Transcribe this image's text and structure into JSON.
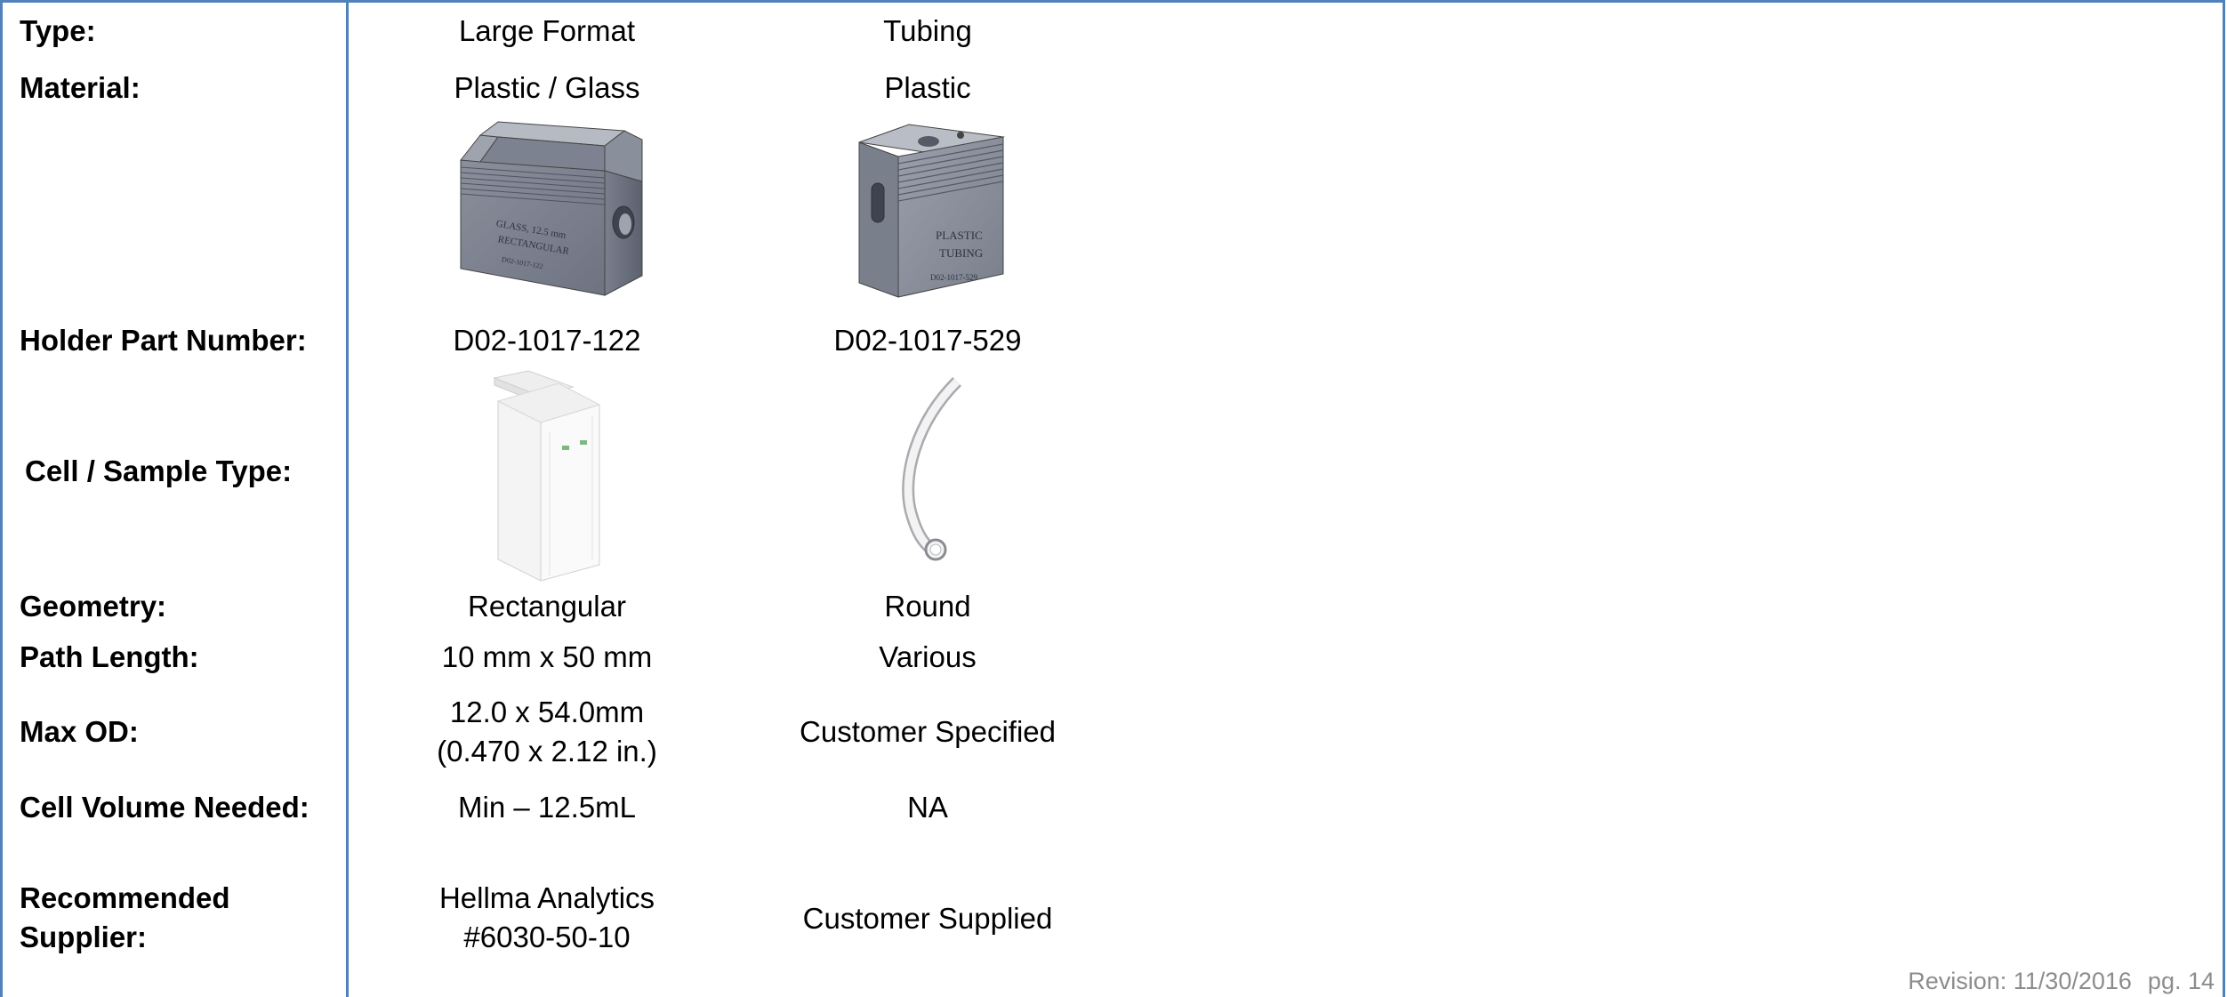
{
  "rows": {
    "type": {
      "label": "Type:",
      "col1": "Large Format",
      "col2": "Tubing"
    },
    "material": {
      "label": "Material:",
      "col1": "Plastic / Glass",
      "col2": "Plastic"
    },
    "holder_part": {
      "label": "Holder Part Number:",
      "col1": "D02-1017-122",
      "col2": "D02-1017-529"
    },
    "cell_sample": {
      "label": "Cell / Sample Type:"
    },
    "geometry": {
      "label": "Geometry:",
      "col1": "Rectangular",
      "col2": "Round"
    },
    "path_length": {
      "label": "Path Length:",
      "col1": "10 mm x 50 mm",
      "col2": "Various"
    },
    "max_od": {
      "label": "Max OD:",
      "col1_line1": "12.0  x 54.0mm",
      "col1_line2": "(0.470 x 2.12 in.)",
      "col2": "Customer Specified"
    },
    "cell_volume": {
      "label": "Cell Volume Needed:",
      "col1": "Min – 12.5mL",
      "col2": "NA"
    },
    "supplier": {
      "label_line1": "Recommended",
      "label_line2": "Supplier:",
      "col1_line1": "Hellma Analytics",
      "col1_line2": "#6030-50-10",
      "col2": "Customer Supplied"
    }
  },
  "images": {
    "holder1_text": [
      "GLASS, 12.5 mm",
      "RECTANGULAR",
      "D02-1017-122"
    ],
    "holder2_text": [
      "PLASTIC",
      "TUBING",
      "D02-1017-529"
    ]
  },
  "footer": {
    "revision": "Revision: 11/30/2016",
    "page": "pg. 14"
  },
  "colors": {
    "border": "#4f81bd",
    "footer_text": "#8c8c8c"
  }
}
